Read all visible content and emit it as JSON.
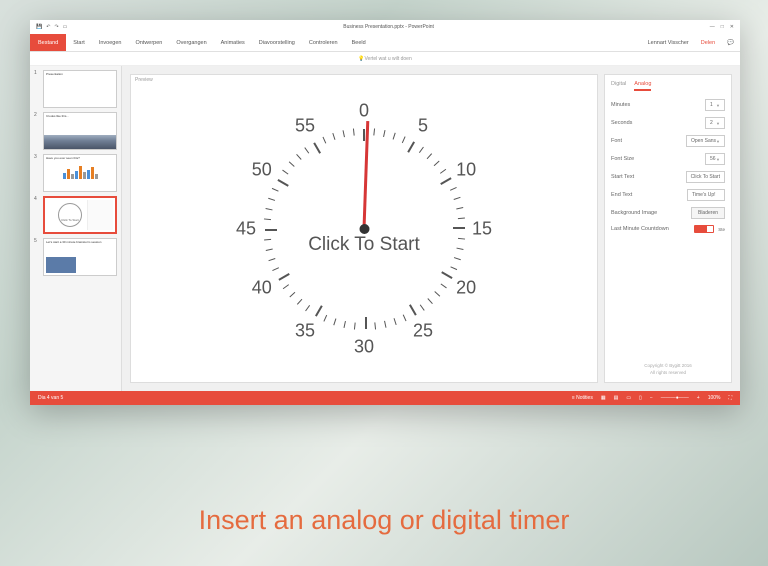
{
  "qat": {
    "title": "Business Presentation.pptx - PowerPoint"
  },
  "ribbon": {
    "file": "Bestand",
    "tabs": [
      "Start",
      "Invoegen",
      "Ontwerpen",
      "Overgangen",
      "Animaties",
      "Diavoorstelling",
      "Controleren",
      "Beeld"
    ],
    "search": "Vertel wat u wilt doen",
    "user": "Lennart Visscher",
    "share": "Delen"
  },
  "thumbs": [
    {
      "num": "1",
      "title": "Presentation"
    },
    {
      "num": "2",
      "title": "It looks like this..."
    },
    {
      "num": "3",
      "title": "Have you ever seen this?"
    },
    {
      "num": "4",
      "title": "Click To Start"
    },
    {
      "num": "5",
      "title": "Let's start a 30 minute brainstorm session"
    }
  ],
  "preview": {
    "label": "Preview",
    "centerText": "Click To Start"
  },
  "clockNumbers": [
    "0",
    "5",
    "10",
    "15",
    "20",
    "25",
    "30",
    "35",
    "40",
    "45",
    "50",
    "55"
  ],
  "panel": {
    "tabs": {
      "digital": "Digital",
      "analog": "Analog"
    },
    "minutes": {
      "label": "Minutes",
      "value": "1"
    },
    "seconds": {
      "label": "Seconds",
      "value": "2"
    },
    "font": {
      "label": "Font",
      "value": "Open Sans"
    },
    "fontSize": {
      "label": "Font Size",
      "value": "56"
    },
    "startText": {
      "label": "Start Text",
      "value": "Click To Start"
    },
    "endText": {
      "label": "End Text",
      "value": "Time's Up!"
    },
    "bgImage": {
      "label": "Background Image",
      "button": "Bladeren"
    },
    "lastMinute": {
      "label": "Last Minute Countdown",
      "yes": "Ste"
    },
    "copyright1": "Copyright © Bygitt 2016",
    "copyright2": "All rights reserved"
  },
  "statusbar": {
    "left": "Dia 4 van 5",
    "notes": "Notities",
    "zoom": "100%"
  },
  "caption": "Insert an analog or digital timer"
}
